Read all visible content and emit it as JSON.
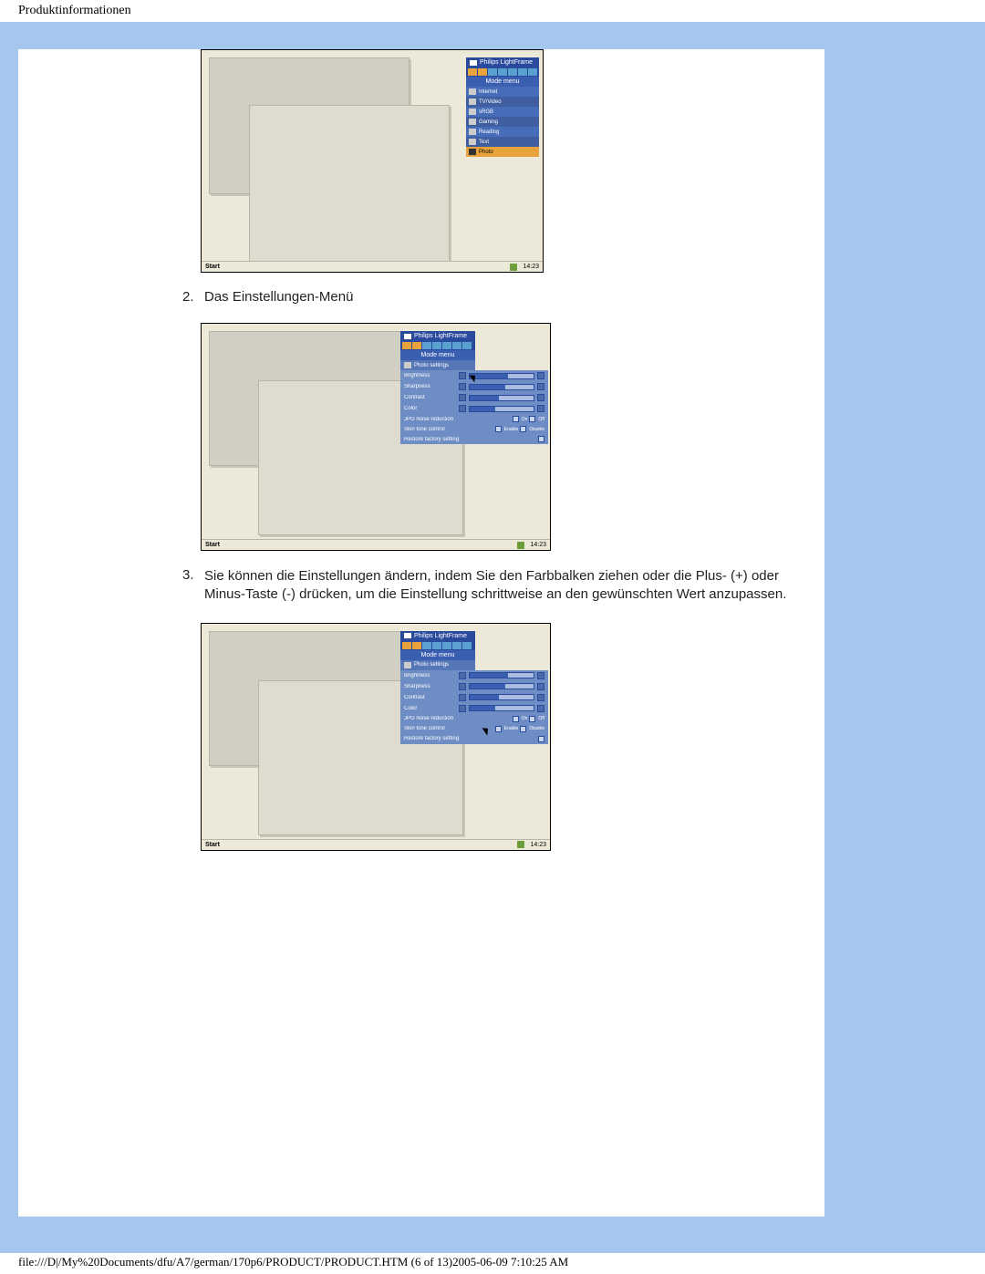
{
  "header": {
    "title": "Produktinformationen"
  },
  "steps": {
    "n2": "2.",
    "t2": "Das Einstellungen-Menü",
    "n3": "3.",
    "t3": "Sie können die Einstellungen ändern, indem Sie den Farbbalken ziehen oder die Plus- (+) oder Minus-Taste (-) drücken, um die Einstellung schrittweise an den gewünschten Wert anzupassen."
  },
  "menu": {
    "title": "Philips LightFrame",
    "mode_header": "Mode menu",
    "items": [
      "Internet",
      "TV/Video",
      "sRGB",
      "Gaming",
      "Reading",
      "Text",
      "Photo"
    ]
  },
  "settings": {
    "title": "Philips LightFrame",
    "mode_header": "Mode menu",
    "selected": "Photo settings",
    "rows": {
      "brightness": "Brightness",
      "sharpness": "Sharpness",
      "contrast": "Contrast",
      "color": "Color",
      "jpg": "JPG noise reduction",
      "jpg_on": "On",
      "jpg_off": "Off",
      "skin": "Skin tone control",
      "skin_enable": "Enable",
      "skin_disable": "Disable",
      "restore": "Restore factory settings"
    }
  },
  "taskbar": {
    "start": "Start",
    "time1": "14:23",
    "time2": "14:23",
    "time3": "14:23"
  },
  "footer": {
    "text": "file:///D|/My%20Documents/dfu/A7/german/170p6/PRODUCT/PRODUCT.HTM (6 of 13)2005-06-09 7:10:25 AM"
  }
}
